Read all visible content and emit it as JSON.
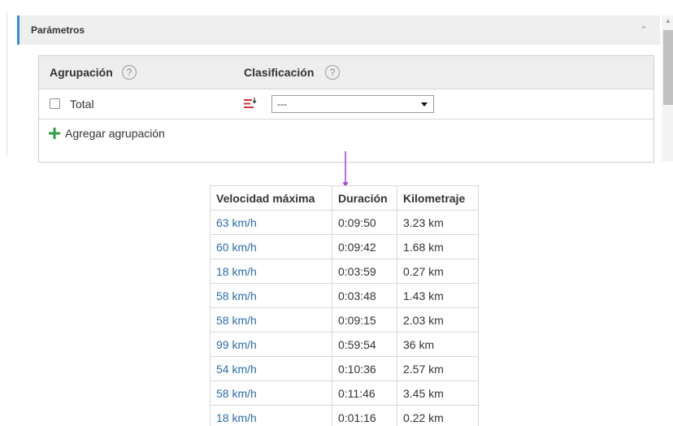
{
  "params": {
    "title": "Parámetros"
  },
  "grouping": {
    "headers": {
      "grouping": "Agrupación",
      "sorting": "Clasificación"
    },
    "help_symbol": "?",
    "row": {
      "label": "Total",
      "checked": false,
      "sort_value": "---"
    },
    "add_label": "Agregar agrupación"
  },
  "colors": {
    "accent": "#2f8ee0",
    "link": "#2a6db0",
    "add_green": "#2ea043",
    "sort_red": "#d4333f",
    "arrow_purple": "#a64ae0"
  },
  "table": {
    "columns": [
      "Velocidad máxima",
      "Duración",
      "Kilometraje"
    ],
    "rows": [
      [
        "63 km/h",
        "0:09:50",
        "3.23 km"
      ],
      [
        "60 km/h",
        "0:09:42",
        "1.68 km"
      ],
      [
        "18 km/h",
        "0:03:59",
        "0.27 km"
      ],
      [
        "58 km/h",
        "0:03:48",
        "1.43 km"
      ],
      [
        "58 km/h",
        "0:09:15",
        "2.03 km"
      ],
      [
        "99 km/h",
        "0:59:54",
        "36 km"
      ],
      [
        "54 km/h",
        "0:10:36",
        "2.57 km"
      ],
      [
        "58 km/h",
        "0:11:46",
        "3.45 km"
      ],
      [
        "18 km/h",
        "0:01:16",
        "0.22 km"
      ]
    ]
  }
}
